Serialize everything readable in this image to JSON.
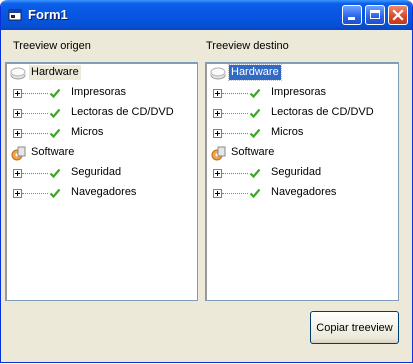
{
  "window": {
    "title": "Form1",
    "icons": {
      "app": "form-app-icon",
      "minimize": "minimize-icon",
      "maximize": "maximize-icon",
      "close": "close-icon"
    }
  },
  "labels": {
    "source": "Treeview origen",
    "destination": "Treeview destino"
  },
  "tree_source": {
    "roots": [
      {
        "label": "Hardware",
        "icon": "drive-icon",
        "children": [
          "Impresoras",
          "Lectoras de CD/DVD",
          "Micros"
        ]
      },
      {
        "label": "Software",
        "icon": "disc-icon",
        "children": [
          "Seguridad",
          "Navegadores"
        ]
      }
    ]
  },
  "tree_destination": {
    "selected": "Hardware",
    "roots": [
      {
        "label": "Hardware",
        "icon": "drive-icon",
        "children": [
          "Impresoras",
          "Lectoras de CD/DVD",
          "Micros"
        ]
      },
      {
        "label": "Software",
        "icon": "disc-icon",
        "children": [
          "Seguridad",
          "Navegadores"
        ]
      }
    ]
  },
  "buttons": {
    "copy": "Copiar treeview"
  },
  "colors": {
    "titlebar": "#0a5fe8",
    "selection": "#316ac5",
    "check": "#3fa52a"
  }
}
